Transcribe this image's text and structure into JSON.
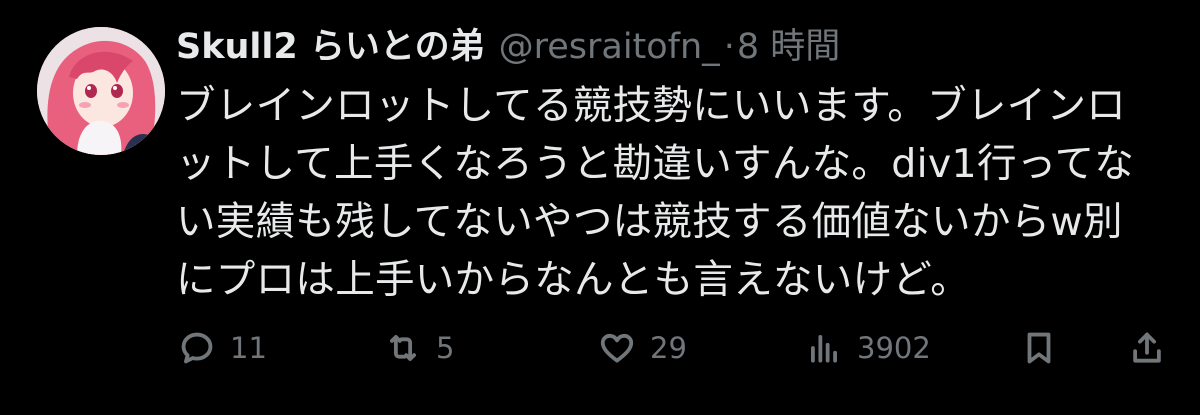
{
  "author": {
    "display_name": "Skull2 らいとの弟",
    "handle": "@resraitofn_",
    "separator": "·",
    "time": "8 時間"
  },
  "tweet": {
    "lines": [
      "ブレインロットしてる競技勢にいいます。ブレインロ",
      "ットして上手くなろうと勘違いすんな。div1行ってな",
      "い実績も残してないやつは競技する価値ないからw別",
      "にプロは上手いからなんとも言えないけど。"
    ]
  },
  "actions": {
    "reply_count": "11",
    "retweet_count": "5",
    "like_count": "29",
    "views_count": "3902",
    "reply_icon": "reply-icon",
    "retweet_icon": "retweet-icon",
    "like_icon": "heart-icon",
    "views_icon": "views-icon",
    "bookmark_icon": "bookmark-icon",
    "share_icon": "share-icon"
  },
  "colors": {
    "background": "#000000",
    "primary_text": "#e7e9ea",
    "secondary_text": "#71767b"
  }
}
